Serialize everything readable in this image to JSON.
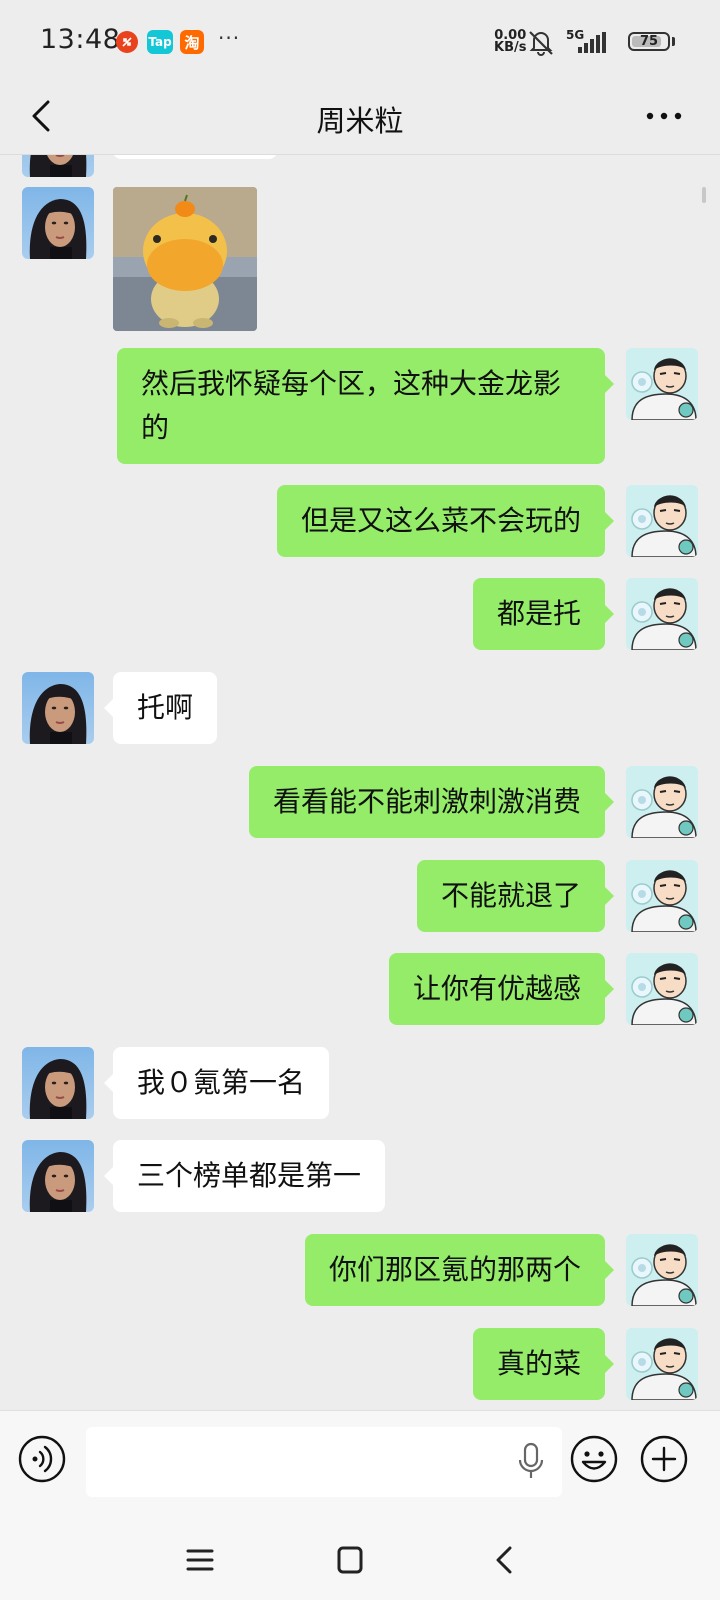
{
  "status_bar": {
    "time": "13:48",
    "apps": [
      {
        "name": "app-notify",
        "color": "#e8431d",
        "label": ""
      },
      {
        "name": "taptap",
        "color": "#14c7d6",
        "label": "Tap"
      },
      {
        "name": "taobao",
        "color": "#ff6a00",
        "label": "淘"
      }
    ],
    "more": "···",
    "net_speed": "0.00",
    "net_unit": "KB/s",
    "signal_label": "5G",
    "battery": "75"
  },
  "header": {
    "title": "周米粒"
  },
  "messages": [
    {
      "side": "left",
      "type": "partial"
    },
    {
      "side": "left",
      "type": "sticker",
      "desc": "yellow-hippo"
    },
    {
      "side": "right",
      "type": "text",
      "text": "然后我怀疑每个区，这种大金龙影的"
    },
    {
      "side": "right",
      "type": "text",
      "text": "但是又这么菜不会玩的"
    },
    {
      "side": "right",
      "type": "text",
      "text": "都是托"
    },
    {
      "side": "left",
      "type": "text",
      "text": "托啊"
    },
    {
      "side": "right",
      "type": "text",
      "text": "看看能不能刺激刺激消费"
    },
    {
      "side": "right",
      "type": "text",
      "text": "不能就退了"
    },
    {
      "side": "right",
      "type": "text",
      "text": "让你有优越感"
    },
    {
      "side": "left",
      "type": "text",
      "text": "我０氪第一名"
    },
    {
      "side": "left",
      "type": "text",
      "text": "三个榜单都是第一"
    },
    {
      "side": "right",
      "type": "text",
      "text": "你们那区氪的那两个"
    },
    {
      "side": "right",
      "type": "text",
      "text": "真的菜"
    }
  ],
  "input": {
    "value": "",
    "placeholder": ""
  },
  "colors": {
    "outgoing_bubble": "#95ec69",
    "incoming_bubble": "#ffffff",
    "background": "#ededed"
  }
}
